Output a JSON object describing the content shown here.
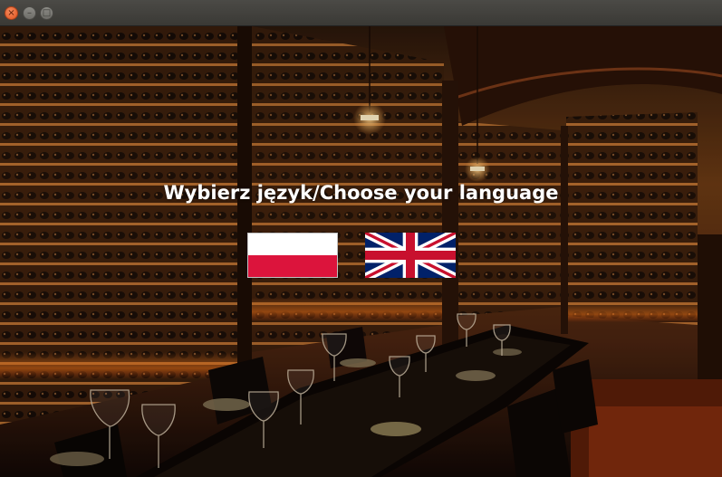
{
  "window": {
    "close_glyph": "×",
    "min_glyph": "–",
    "max_glyph": "□"
  },
  "main": {
    "heading": "Wybierz język/Choose your language",
    "flags": [
      {
        "name": "polish-flag",
        "language": "pl",
        "colors": [
          "#ffffff",
          "#dc143c"
        ]
      },
      {
        "name": "english-flag",
        "language": "en",
        "colors": [
          "#012169",
          "#ffffff",
          "#c8102e"
        ]
      }
    ]
  }
}
